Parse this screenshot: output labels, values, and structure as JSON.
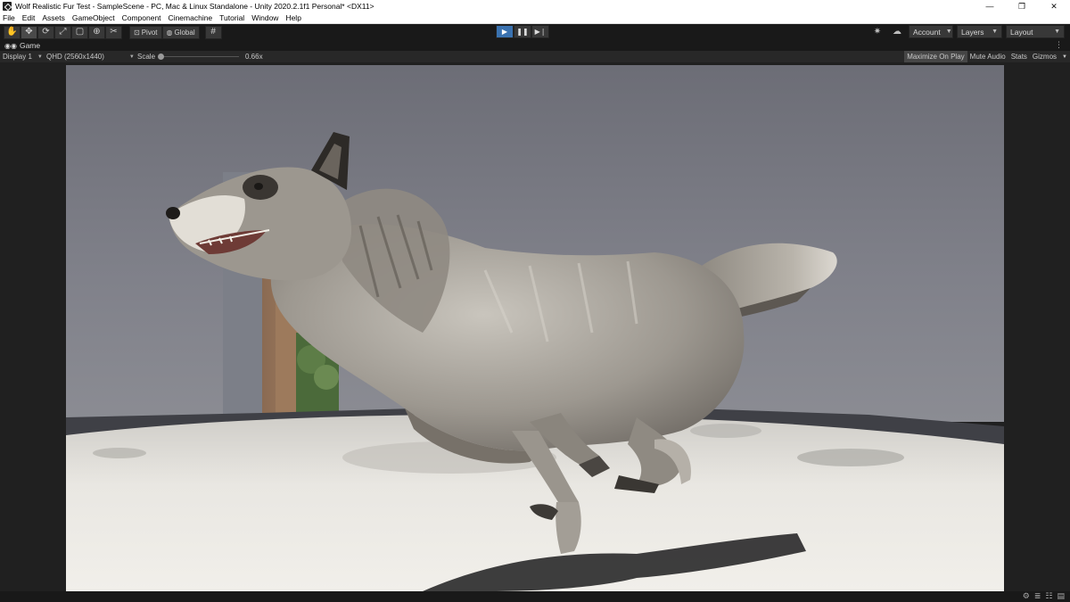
{
  "window": {
    "title": "Wolf Realistic Fur Test - SampleScene - PC, Mac & Linux Standalone - Unity 2020.2.1f1 Personal* <DX11>",
    "minimize": "—",
    "maximize": "❐",
    "close": "✕"
  },
  "menu": {
    "items": [
      "File",
      "Edit",
      "Assets",
      "GameObject",
      "Component",
      "Cinemachine",
      "Tutorial",
      "Window",
      "Help"
    ]
  },
  "toolbar": {
    "tools": [
      "hand-tool",
      "move-tool",
      "rotate-tool",
      "scale-tool",
      "rect-tool",
      "transform-tool",
      "custom-tool"
    ],
    "pivot_label": "Pivot",
    "global_label": "Global",
    "account_label": "Account",
    "layers_label": "Layers",
    "layout_label": "Layout",
    "play_active": true
  },
  "game_tab": {
    "label": "Game"
  },
  "game_view": {
    "display": "Display 1",
    "resolution": "QHD (2560x1440)",
    "scale_label": "Scale",
    "scale_value": "0.66x",
    "maximize_on_play": "Maximize On Play",
    "mute_audio": "Mute Audio",
    "stats": "Stats",
    "gizmos": "Gizmos"
  },
  "colors": {
    "editor_bg": "#191919",
    "panel_bg": "#282828",
    "play_accent": "#3a72b0",
    "wall": "#7a7b83",
    "floor": "#e6e4df"
  }
}
